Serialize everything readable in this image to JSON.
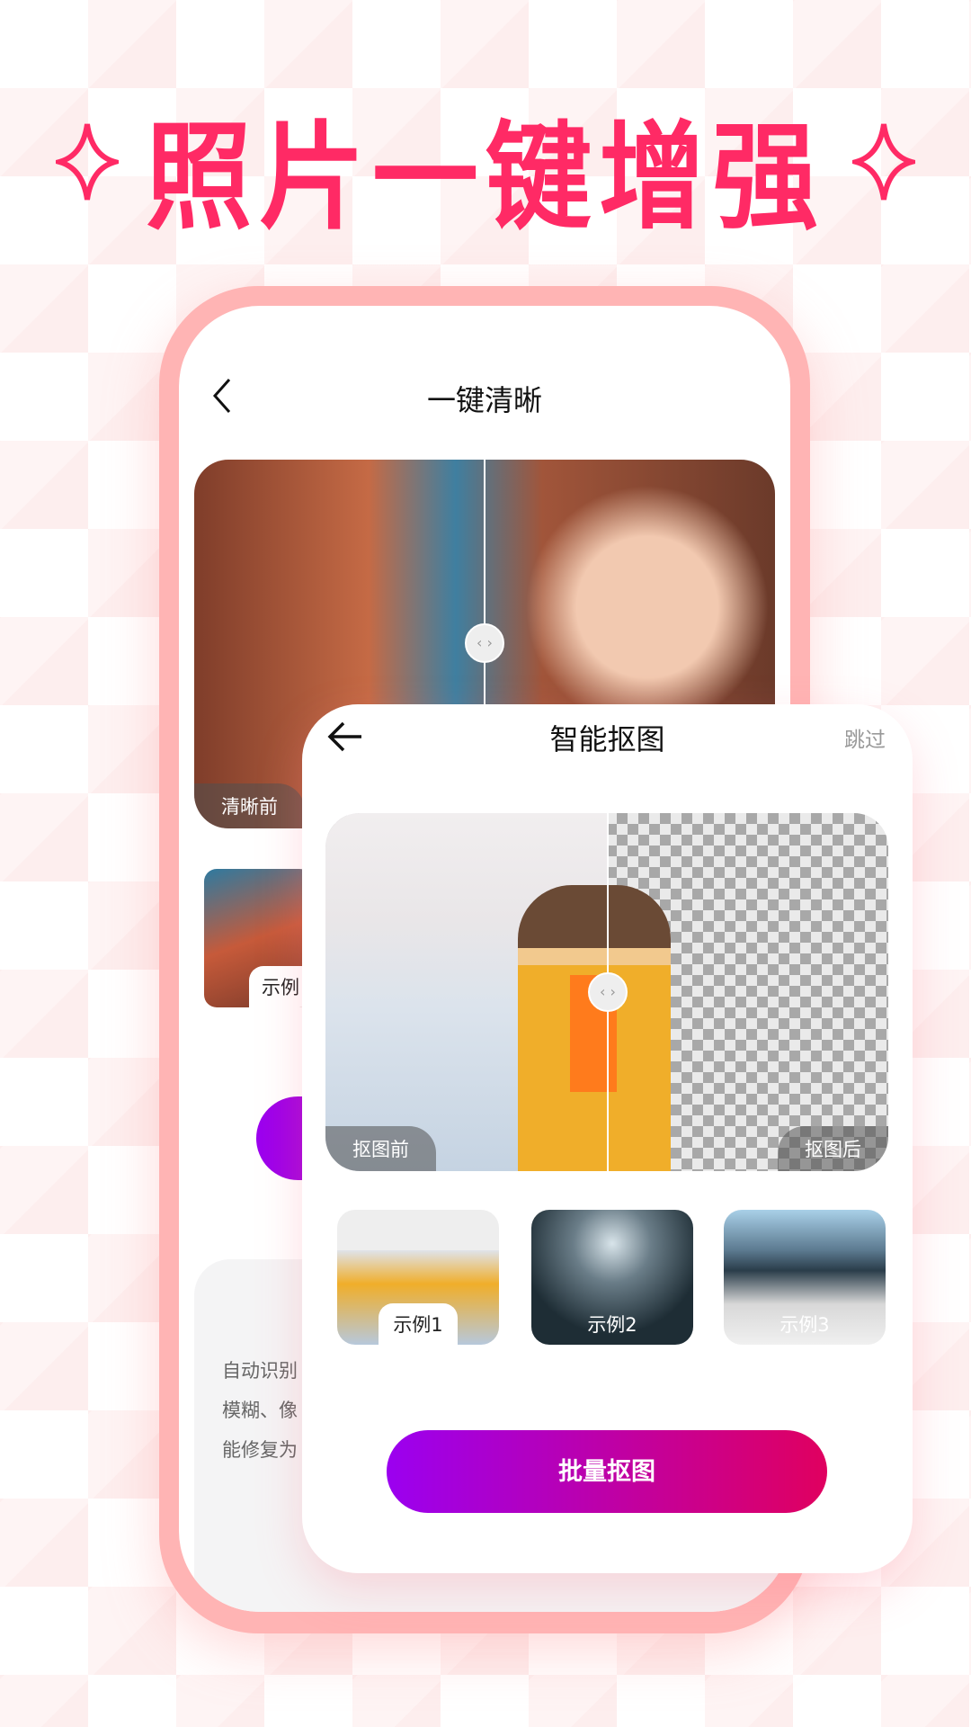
{
  "headline": "照片一键增强",
  "colors": {
    "accent": "#ff2a65",
    "frame": "#ffb4b4",
    "button_start": "#9b00f0",
    "button_end": "#e0005f"
  },
  "back_screen": {
    "title": "一键清晰",
    "back_icon": "chevron-left-icon",
    "before_label": "清晰前",
    "thumb_label": "示例",
    "description_lines": [
      "自动识别",
      "模糊、像",
      "能修复为"
    ]
  },
  "front_screen": {
    "title": "智能抠图",
    "back_icon": "arrow-left-icon",
    "skip_label": "跳过",
    "before_label": "抠图前",
    "after_label": "抠图后",
    "examples": [
      {
        "label": "示例1"
      },
      {
        "label": "示例2"
      },
      {
        "label": "示例3"
      }
    ],
    "action_label": "批量抠图"
  }
}
